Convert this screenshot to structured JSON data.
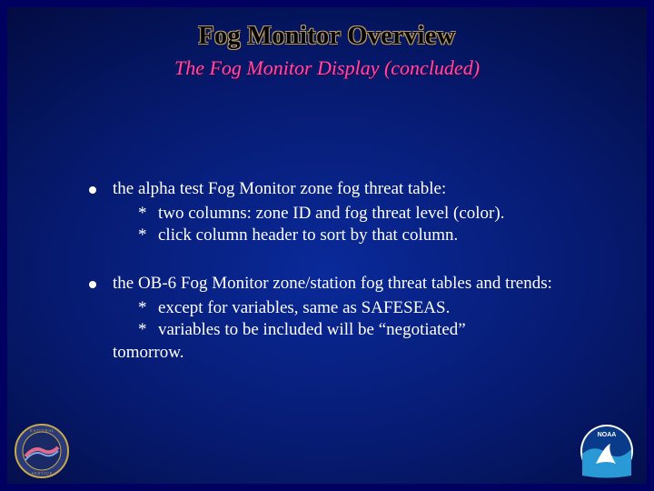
{
  "title": "Fog Monitor Overview",
  "subtitle": "The Fog Monitor Display (concluded)",
  "bullets": [
    {
      "lead": "the alpha test Fog Monitor zone fog threat table:",
      "subs": [
        "two columns: zone ID and fog threat level (color).",
        "click column header to sort by that column."
      ]
    },
    {
      "lead": "the OB-6 Fog Monitor zone/station fog threat tables and trends:",
      "subs": [
        "except for variables, same as SAFESEAS.",
        "variables to be included will be “negotiated”"
      ],
      "cont": "tomorrow."
    }
  ],
  "logos": {
    "left": "nws-seal",
    "right": "noaa-seal",
    "right_label": "NOAA"
  }
}
